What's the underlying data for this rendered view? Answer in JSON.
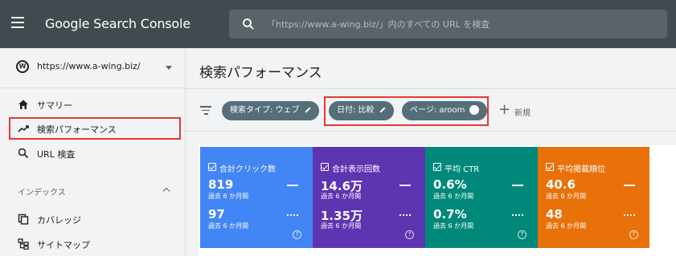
{
  "app": {
    "title": "Google Search Console",
    "search_placeholder": "「https://www.a-wing.biz/」内のすべての URL を検査"
  },
  "sidebar": {
    "property": "https://www.a-wing.biz/",
    "property_icon_letter": "W",
    "items": [
      {
        "label": "サマリー",
        "icon": "home-icon"
      },
      {
        "label": "検索パフォーマンス",
        "icon": "trending-up-icon",
        "active": true
      },
      {
        "label": "URL 検査",
        "icon": "search-icon"
      }
    ],
    "section_index": "インデックス",
    "index_items": [
      {
        "label": "カバレッジ",
        "icon": "copy-icon"
      },
      {
        "label": "サイトマップ",
        "icon": "sitemap-icon"
      }
    ]
  },
  "main": {
    "title": "検索パフォーマンス",
    "filters": {
      "chips": [
        {
          "label": "検索タイプ: ウェブ",
          "action": "edit"
        },
        {
          "label": "日付: 比較",
          "action": "edit"
        },
        {
          "label": "ページ: aroom",
          "action": "remove"
        }
      ],
      "new_label": "新規",
      "new_symbol": "+"
    },
    "metrics": [
      {
        "title": "合計クリック数",
        "value1": "819",
        "period1": "過去 6 か月間",
        "value2": "97",
        "period2": "過去 6 か月間",
        "color": "#4285f4"
      },
      {
        "title": "合計表示回数",
        "value1": "14.6万",
        "period1": "過去 6 か月間",
        "value2": "1.35万",
        "period2": "過去 6 か月間",
        "color": "#5e35b1"
      },
      {
        "title": "平均 CTR",
        "value1": "0.6%",
        "period1": "過去 6 か月間",
        "value2": "0.7%",
        "period2": "過去 6 か月間",
        "color": "#00897b"
      },
      {
        "title": "平均掲載順位",
        "value1": "40.6",
        "period1": "過去 6 か月間",
        "value2": "48",
        "period2": "過去 6 か月間",
        "color": "#e8710a"
      }
    ],
    "help_symbol": "?"
  }
}
